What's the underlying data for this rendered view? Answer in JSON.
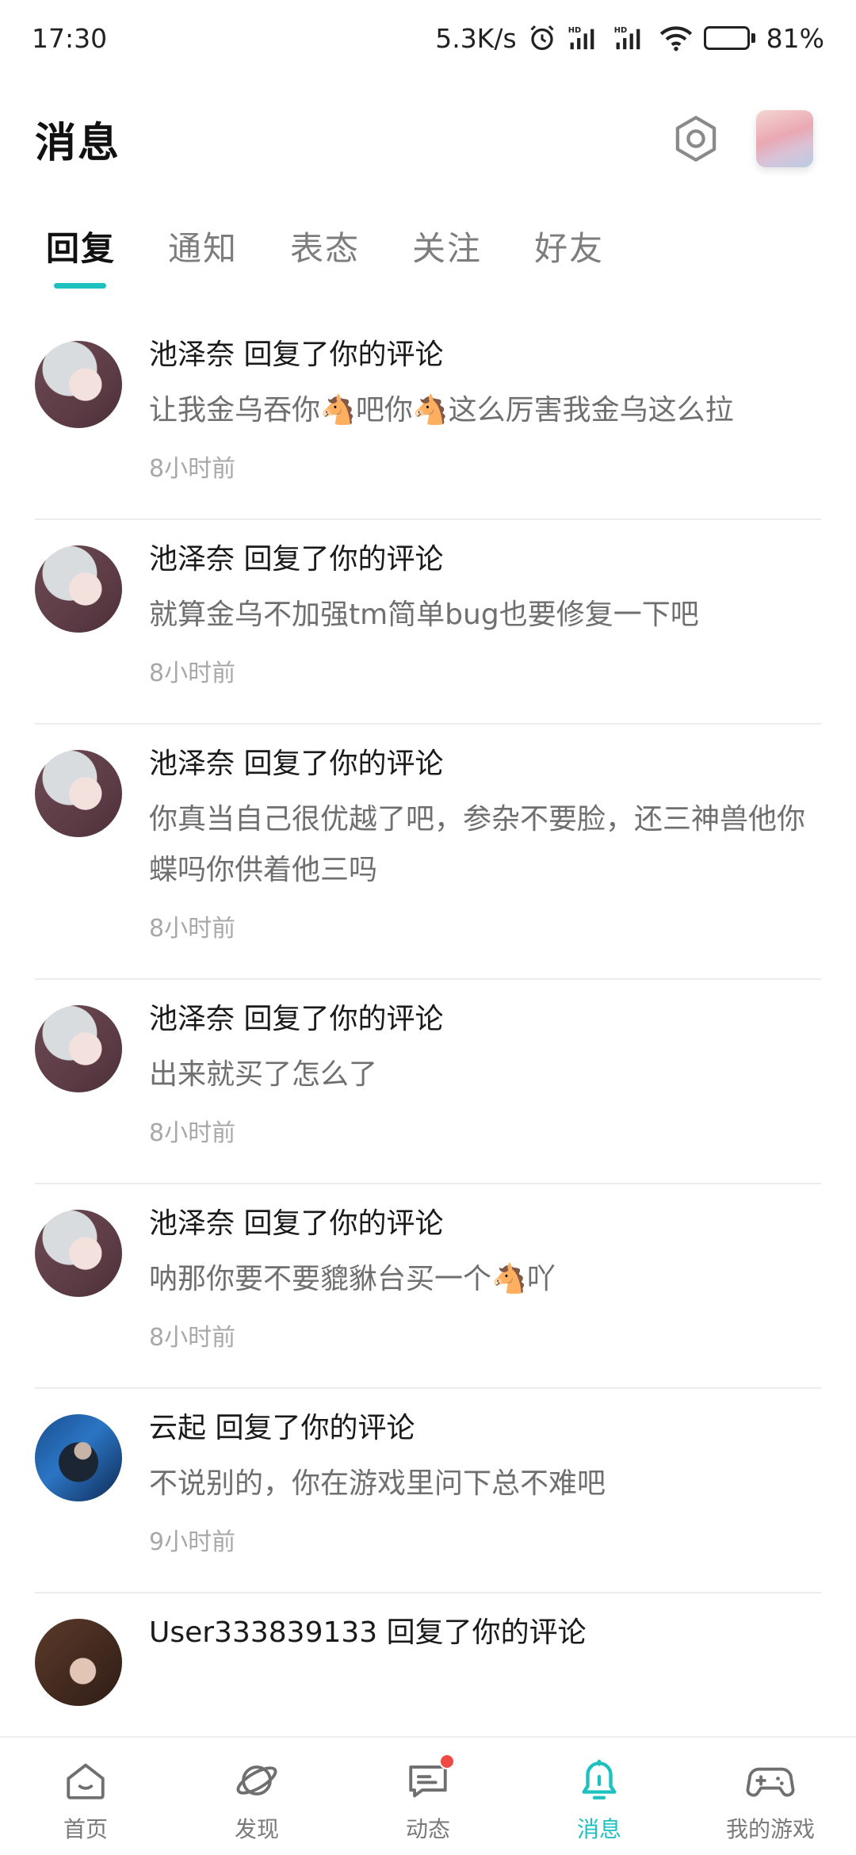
{
  "status_bar": {
    "time": "17:30",
    "network_speed": "5.3K/s",
    "battery": "81%",
    "battery_level": 0.81,
    "icons": [
      "alarm-icon",
      "signal-hd-icon",
      "signal-hd-icon",
      "wifi-icon",
      "battery-icon"
    ]
  },
  "header": {
    "title": "消息"
  },
  "tabs": [
    {
      "label": "回复",
      "active": true
    },
    {
      "label": "通知",
      "active": false
    },
    {
      "label": "表态",
      "active": false
    },
    {
      "label": "关注",
      "active": false
    },
    {
      "label": "好友",
      "active": false
    }
  ],
  "messages": [
    {
      "title": "池泽奈 回复了你的评论",
      "text": "让我金乌吞你🐴吧你🐴这么厉害我金乌这么拉",
      "time": "8小时前"
    },
    {
      "title": "池泽奈 回复了你的评论",
      "text": "就算金乌不加强tm简单bug也要修复一下吧",
      "time": "8小时前"
    },
    {
      "title": "池泽奈 回复了你的评论",
      "text": "你真当自己很优越了吧，参杂不要脸，还三神兽他你蝶吗你供着他三吗",
      "time": "8小时前"
    },
    {
      "title": "池泽奈 回复了你的评论",
      "text": "出来就买了怎么了",
      "time": "8小时前"
    },
    {
      "title": "池泽奈 回复了你的评论",
      "text": "呐那你要不要貔貅台买一个🐴吖",
      "time": "8小时前"
    },
    {
      "title": "云起 回复了你的评论",
      "text": "不说别的，你在游戏里问下总不难吧",
      "time": "9小时前"
    },
    {
      "title": "User333839133 回复了你的评论",
      "text": "",
      "time": ""
    }
  ],
  "bottom_nav": [
    {
      "label": "首页",
      "icon": "home-icon",
      "active": false
    },
    {
      "label": "发现",
      "icon": "planet-icon",
      "active": false
    },
    {
      "label": "动态",
      "icon": "chat-bubble-icon",
      "active": false,
      "badge": true
    },
    {
      "label": "消息",
      "icon": "bell-icon",
      "active": true
    },
    {
      "label": "我的游戏",
      "icon": "gamepad-icon",
      "active": false
    }
  ],
  "colors": {
    "accent": "#1ec0c0",
    "badge": "#f04a46",
    "muted_text": "#6f6f6f",
    "time_text": "#a8a8a8"
  }
}
